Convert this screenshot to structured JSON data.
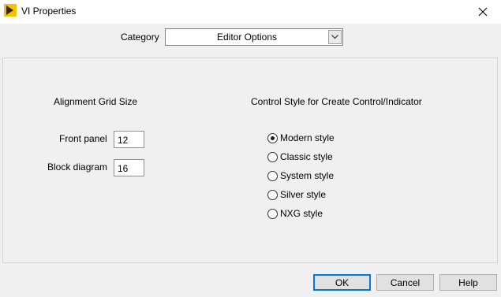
{
  "window": {
    "title": "VI Properties",
    "app_icon": "labview-arrow-icon",
    "close_icon": "close-icon"
  },
  "category": {
    "label": "Category",
    "selected": "Editor Options"
  },
  "alignment_grid": {
    "heading": "Alignment Grid Size",
    "front_panel_label": "Front panel",
    "front_panel_value": "12",
    "block_diagram_label": "Block diagram",
    "block_diagram_value": "16"
  },
  "control_style": {
    "heading": "Control Style for Create Control/Indicator",
    "options": [
      {
        "label": "Modern style",
        "checked": true
      },
      {
        "label": "Classic style",
        "checked": false
      },
      {
        "label": "System style",
        "checked": false
      },
      {
        "label": "Silver style",
        "checked": false
      },
      {
        "label": "NXG style",
        "checked": false
      }
    ]
  },
  "buttons": {
    "ok": "OK",
    "cancel": "Cancel",
    "help": "Help"
  },
  "colors": {
    "accent": "#0078d7",
    "icon_yellow": "#f2c200"
  }
}
